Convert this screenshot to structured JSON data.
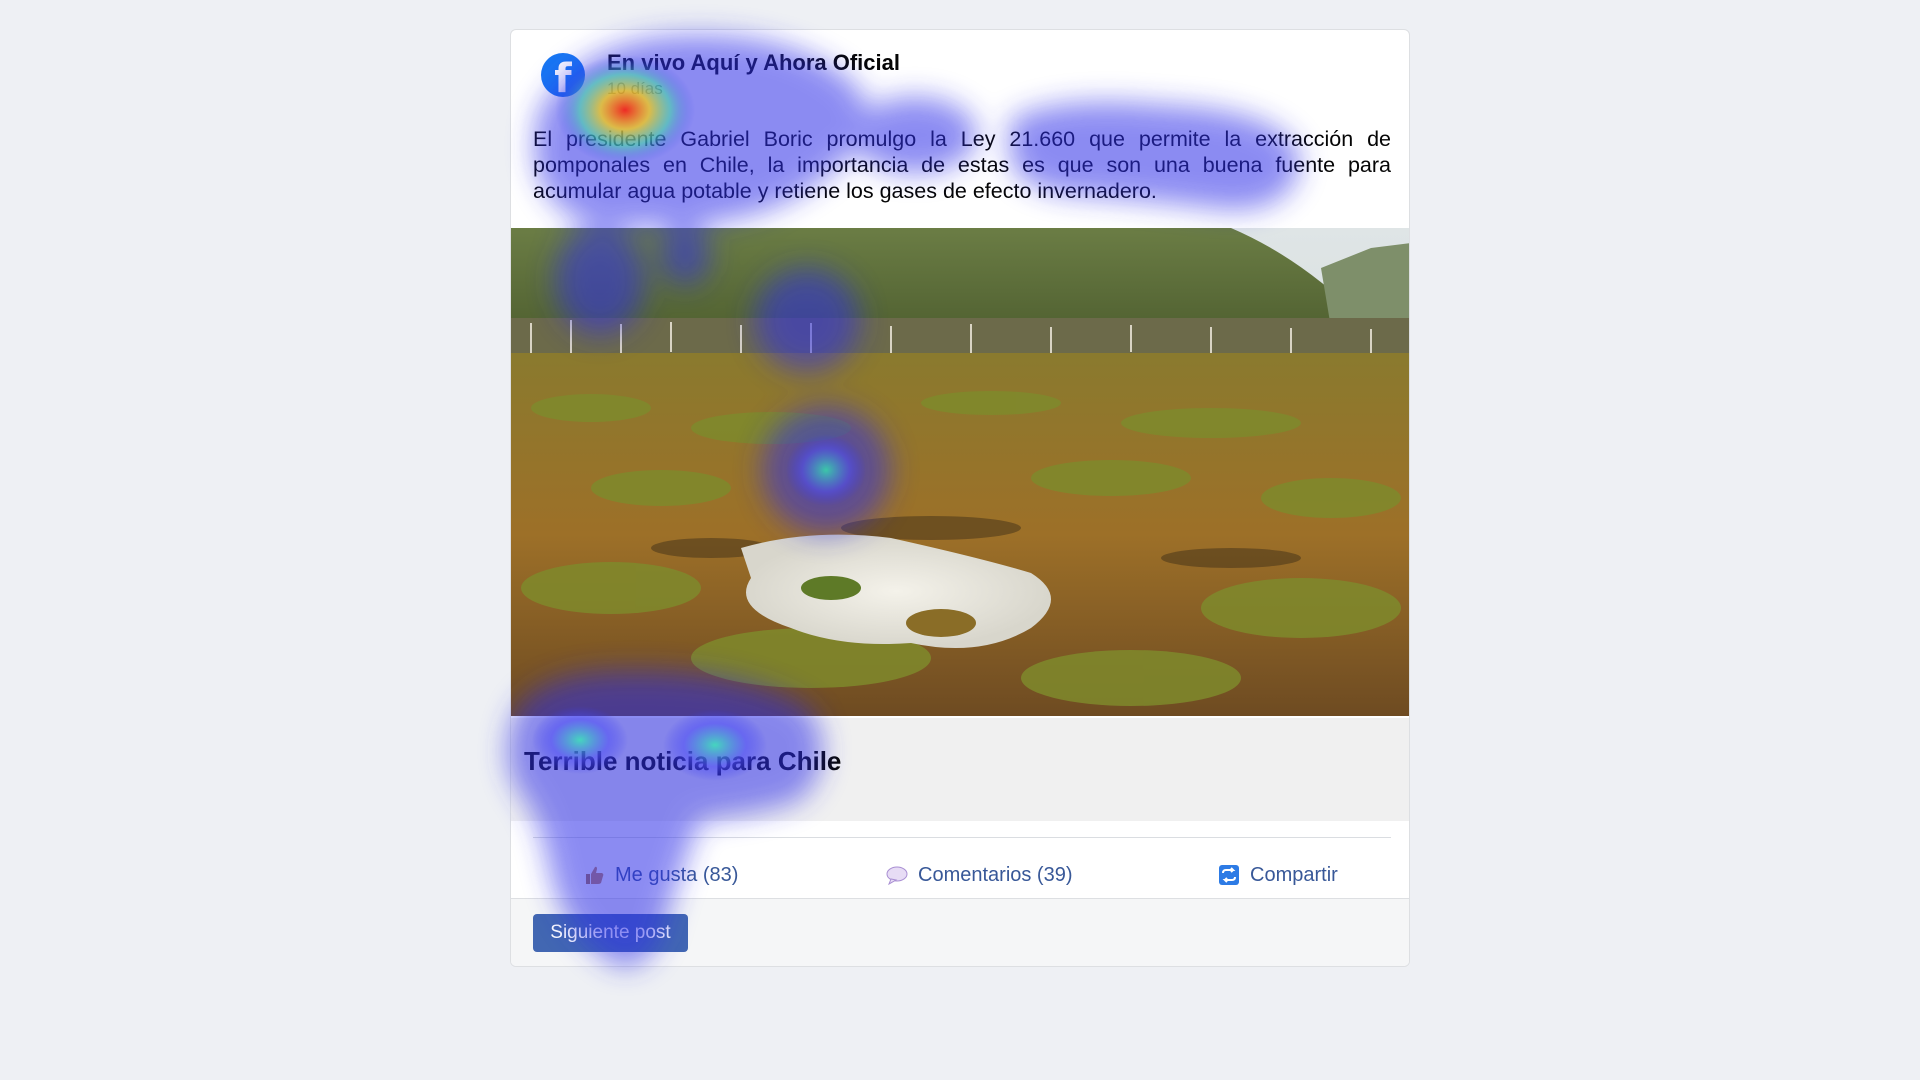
{
  "post": {
    "author": "En vivo Aquí y Ahora Oficial",
    "time": "10 días",
    "text": "El presidente Gabriel Boric promulgo la Ley 21.660 que permite la extracción de pomponales en Chile, la importancia de estas es que son una buena fuente para acumular agua potable y retiene los gases de efecto invernadero.",
    "logo_icon": "facebook-logo-icon",
    "logo_glyph": "f",
    "image_icon": "peat-bog-landscape-photo",
    "link_title": "Terrible noticia para Chile"
  },
  "actions": {
    "like": {
      "label": "Me gusta (83)",
      "icon": "thumbs-up-icon"
    },
    "comments": {
      "label": "Comentarios (39)",
      "icon": "speech-bubble-icon"
    },
    "share": {
      "label": "Compartir",
      "icon": "share-icon"
    }
  },
  "footer": {
    "next_label": "Siguiente post"
  },
  "colors": {
    "page_bg": "#eef0f4",
    "link_blue": "#385898",
    "button_blue": "#4267b2",
    "facebook_blue": "#1877f2"
  }
}
